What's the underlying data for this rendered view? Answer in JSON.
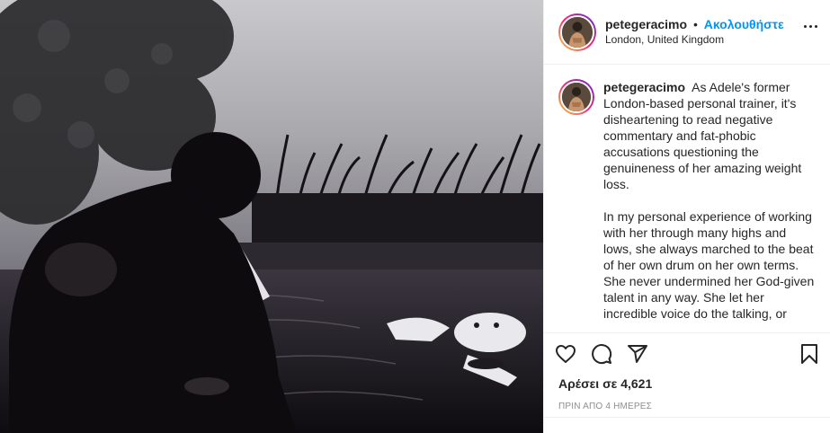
{
  "post": {
    "username": "petegeracimo",
    "separator": "•",
    "follow_label": "Ακολουθήστε",
    "location": "London, United Kingdom",
    "caption_paragraphs": [
      "As Adele's former London-based personal trainer, it's disheartening to read negative commentary and fat-phobic accusations questioning the genuineness of her amazing weight loss.",
      "In my personal experience of working with her through many highs and lows, she always marched to the beat of her own drum on her own terms. She never undermined her God-given talent in any way. She let her incredible voice do the talking, or"
    ],
    "likes_text": "Αρέσει σε 4,621",
    "time_ago": "ΠΡΙΝ ΑΠΟ 4 ΗΜΕΡΕΣ"
  },
  "icons": {
    "more": "more-options-icon",
    "like": "heart-icon",
    "comment": "comment-icon",
    "share": "share-icon",
    "save": "bookmark-icon"
  },
  "colors": {
    "follow": "#0095f6",
    "text": "#262626",
    "muted": "#8e8e8e",
    "border": "#efefef"
  }
}
